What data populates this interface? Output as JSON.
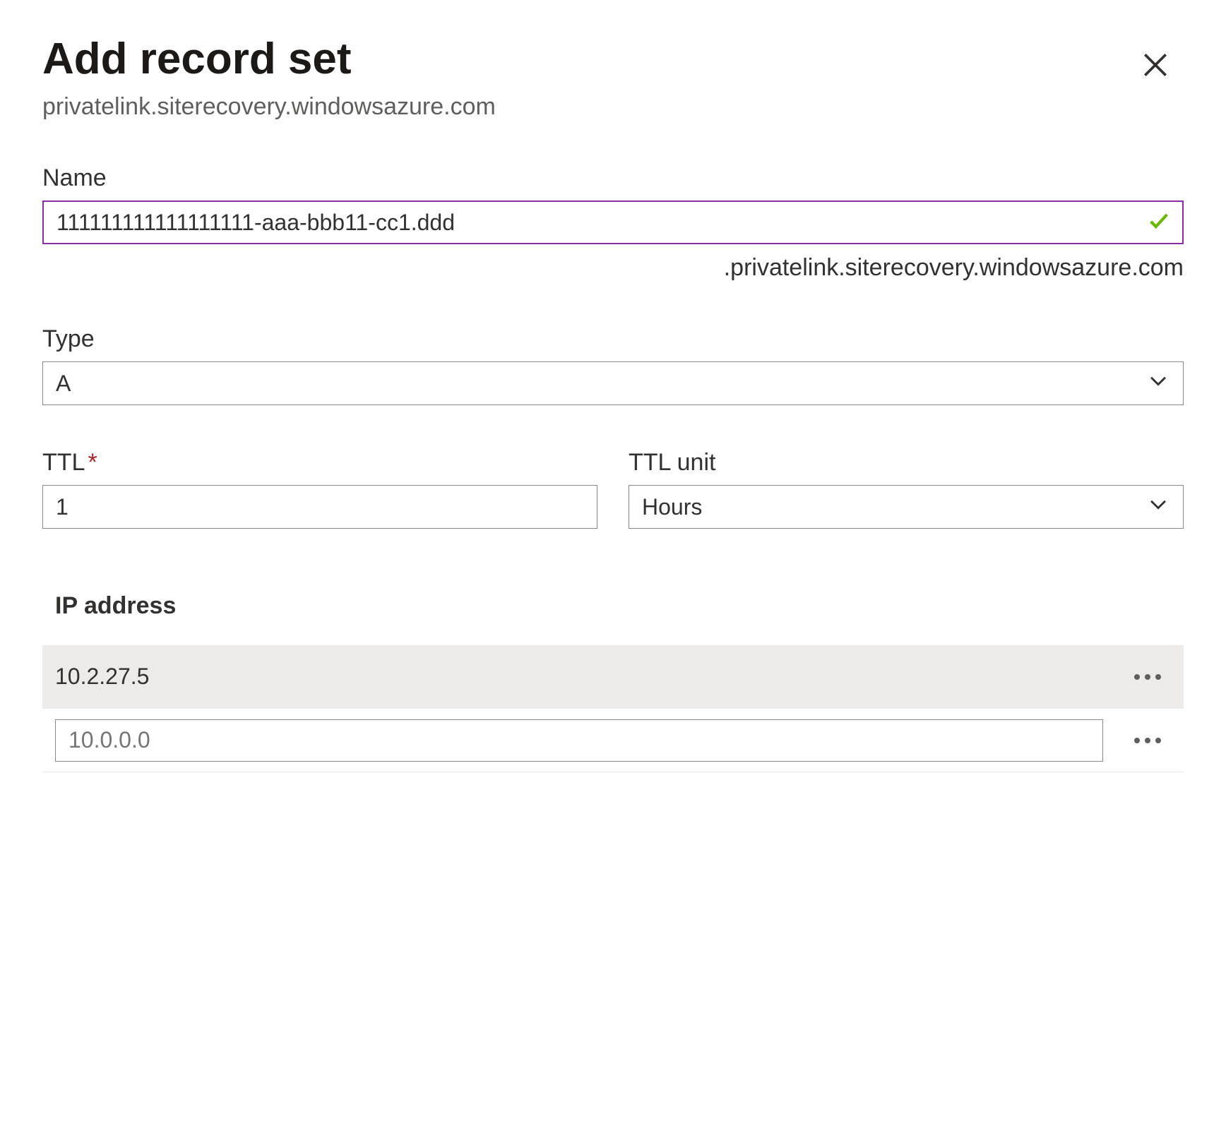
{
  "header": {
    "title": "Add record set",
    "subtitle": "privatelink.siterecovery.windowsazure.com"
  },
  "form": {
    "name": {
      "label": "Name",
      "value": "111111111111111111-aaa-bbb11-cc1.ddd",
      "suffix": ".privatelink.siterecovery.windowsazure.com"
    },
    "type": {
      "label": "Type",
      "value": "A"
    },
    "ttl": {
      "label": "TTL",
      "value": "1"
    },
    "ttl_unit": {
      "label": "TTL unit",
      "value": "Hours"
    },
    "ip_section": {
      "label": "IP address",
      "rows": [
        {
          "value": "10.2.27.5"
        }
      ],
      "placeholder": "10.0.0.0"
    }
  }
}
